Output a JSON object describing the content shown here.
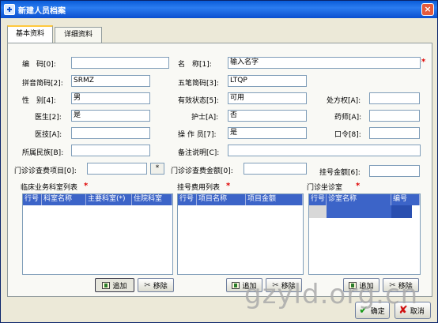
{
  "window": {
    "title": "新建人员档案",
    "close": "×"
  },
  "tabs": [
    {
      "label": "基本资料",
      "active": true
    },
    {
      "label": "详细资料",
      "active": false
    }
  ],
  "form": {
    "code": {
      "label": "编　码[0]:",
      "value": ""
    },
    "name": {
      "label": "名　称[1]:",
      "value": "输入名字"
    },
    "pinyin": {
      "label": "拼音简码[2]:",
      "value": "SRMZ"
    },
    "wubi": {
      "label": "五笔简码[3]:",
      "value": "LTQP"
    },
    "gender": {
      "label": "性　别[4]:",
      "value": "男"
    },
    "status": {
      "label": "有效状态[5]:",
      "value": "可用"
    },
    "prescription": {
      "label": "处方权[A]:",
      "value": ""
    },
    "doctor": {
      "label": "医生[2]:",
      "value": "是"
    },
    "nurse": {
      "label": "护士[A]:",
      "value": "否"
    },
    "pharmacist": {
      "label": "药师[A]:",
      "value": ""
    },
    "tech": {
      "label": "医技[A]:",
      "value": ""
    },
    "operator": {
      "label": "操 作 员[7]:",
      "value": "是"
    },
    "password": {
      "label": "口令[8]:",
      "value": ""
    },
    "ethnicity": {
      "label": "所属民族[B]:",
      "value": ""
    },
    "remark": {
      "label": "备注说明[C]:",
      "value": ""
    },
    "clinic_fee_item": {
      "label": "门诊诊查费项目[0]:",
      "value": "",
      "dots": "*"
    },
    "clinic_fee_amount": {
      "label": "门诊诊查费金额[0]:",
      "value": ""
    },
    "reg_amount": {
      "label": "挂号金额[6]:",
      "value": ""
    }
  },
  "lists": {
    "dept": {
      "title": "临床业务科室列表",
      "columns": [
        "行号",
        "科室名称",
        "主要科室(*)",
        "住院科室"
      ],
      "add": "追加",
      "remove": "移除"
    },
    "fee": {
      "title": "挂号费用列表",
      "columns": [
        "行号",
        "项目名称",
        "项目金额"
      ],
      "add": "追加",
      "remove": "移除"
    },
    "room": {
      "title": "门诊坐诊室",
      "columns": [
        "行号",
        "诊室名称",
        "编号"
      ],
      "add": "追加",
      "remove": "移除"
    }
  },
  "footer": {
    "ok": "确定",
    "cancel": "取消"
  },
  "watermark": "gzyld.org.cn",
  "icons": {
    "add": "table-add-icon",
    "remove": "scissors-icon",
    "ok": "check-icon",
    "cancel": "x-icon"
  }
}
